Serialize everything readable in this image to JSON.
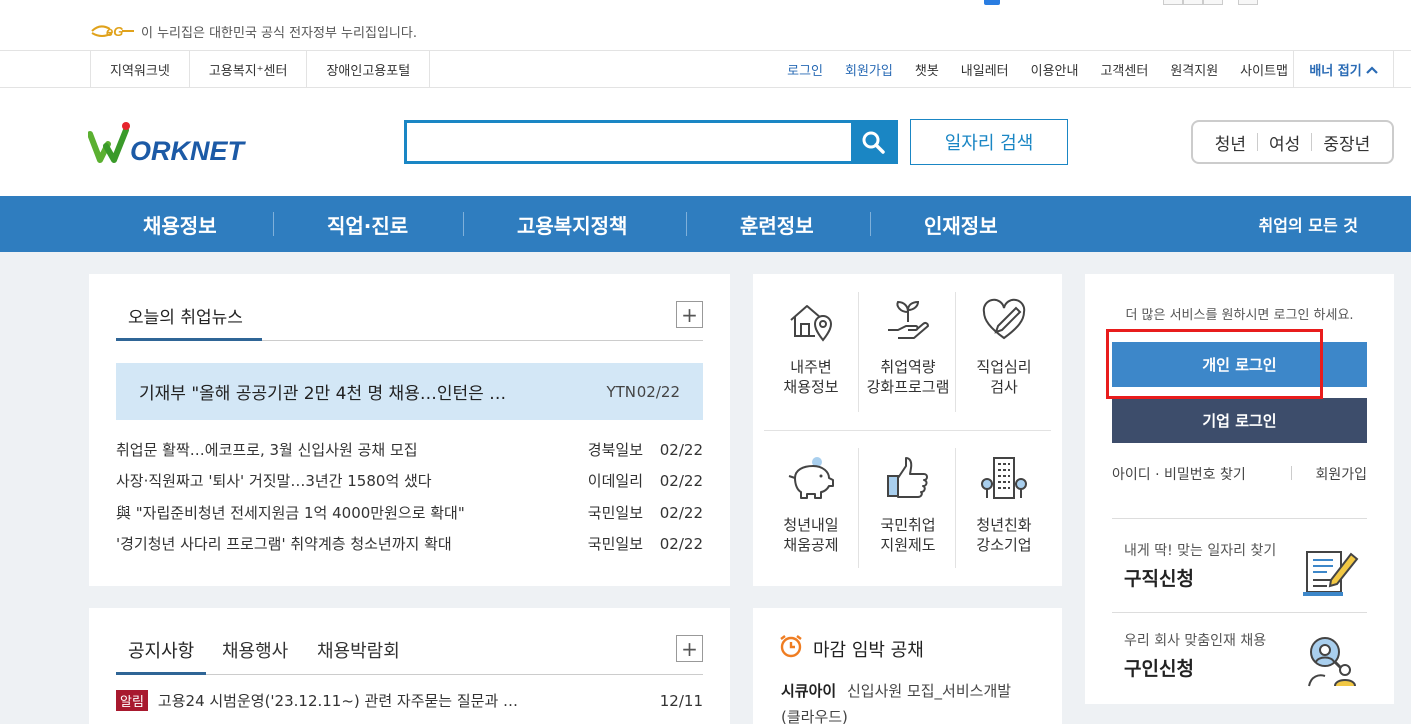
{
  "gov_banner": {
    "logo_text": "eG",
    "text": "이 누리집은 대한민국 공식 전자정부 누리집입니다."
  },
  "util_bar": {
    "left_links": [
      "지역워크넷",
      "고용복지⁺센터",
      "장애인고용포털"
    ],
    "right_links": [
      "로그인",
      "회원가입",
      "챗봇",
      "내일레터",
      "이용안내",
      "고객센터",
      "원격지원",
      "사이트맵"
    ],
    "banner_fold": "배너 접기"
  },
  "header": {
    "logo_text": "ORKNET",
    "search_placeholder": "",
    "job_search_label": "일자리 검색",
    "age_groups": [
      "청년",
      "여성",
      "중장년"
    ]
  },
  "nav": {
    "items": [
      "채용정보",
      "직업·진로",
      "고용복지정책",
      "훈련정보",
      "인재정보"
    ],
    "all_label": "취업의 모든 것"
  },
  "news": {
    "title": "오늘의 취업뉴스",
    "plus": "+",
    "headline": {
      "title": "기재부 \"올해 공공기관 2만 4천 명 채용…인턴은 …",
      "source": "YTN",
      "date": "02/22"
    },
    "items": [
      {
        "title": "취업문 활짝…에코프로, 3월 신입사원 공채 모집",
        "source": "경북일보",
        "date": "02/22"
      },
      {
        "title": "사장·직원짜고 '퇴사' 거짓말…3년간 1580억 샜다",
        "source": "이데일리",
        "date": "02/22"
      },
      {
        "title": "與 \"자립준비청년 전세지원금 1억 4000만원으로 확대\"",
        "source": "국민일보",
        "date": "02/22"
      },
      {
        "title": "'경기청년 사다리 프로그램' 취약계층 청소년까지 확대",
        "source": "국민일보",
        "date": "02/22"
      }
    ]
  },
  "services": {
    "row1": [
      {
        "line1": "내주변",
        "line2": "채용정보",
        "icon": "house-pin-icon"
      },
      {
        "line1": "취업역량",
        "line2": "강화프로그램",
        "icon": "sprout-hand-icon"
      },
      {
        "line1": "직업심리",
        "line2": "검사",
        "icon": "heart-pen-icon"
      }
    ],
    "row2": [
      {
        "line1": "청년내일",
        "line2": "채움공제",
        "icon": "piggy-bank-icon"
      },
      {
        "line1": "국민취업",
        "line2": "지원제도",
        "icon": "thumbs-up-icon"
      },
      {
        "line1": "청년친화",
        "line2": "강소기업",
        "icon": "building-icon"
      }
    ]
  },
  "login": {
    "message": "더 많은 서비스를 원하시면 로그인 하세요.",
    "personal_label": "개인 로그인",
    "company_label": "기업 로그인",
    "find_label": "아이디 · 비밀번호 찾기",
    "join_label": "회원가입",
    "cards": [
      {
        "sub": "내게 딱! 맞는 일자리 찾기",
        "title": "구직신청",
        "icon": "resume-pen-icon"
      },
      {
        "sub": "우리 회사 맞춤인재 채용",
        "title": "구인신청",
        "icon": "person-search-icon"
      }
    ]
  },
  "notice": {
    "tabs": [
      "공지사항",
      "채용행사",
      "채용박람회"
    ],
    "plus": "+",
    "item": {
      "badge": "알림",
      "title": "고용24 시범운영('23.12.11~) 관련 자주묻는 질문과 …",
      "date": "12/11"
    }
  },
  "deadline": {
    "title": "마감 임박 공채",
    "company": "시큐아이",
    "job_line1": "신입사원 모집_서비스개발",
    "job_line2": "(클라우드)"
  }
}
